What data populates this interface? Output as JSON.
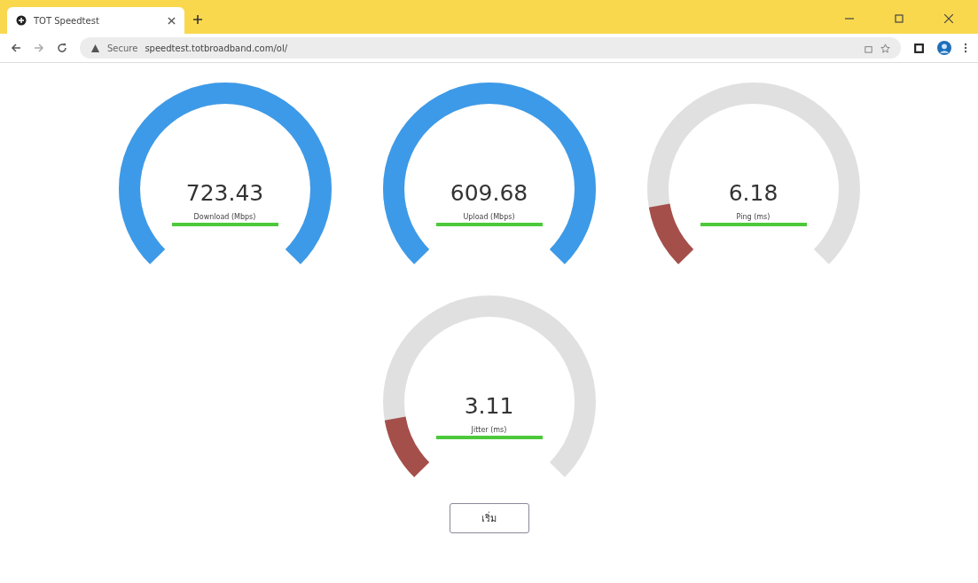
{
  "browser": {
    "tab_title": "TOT Speedtest",
    "security": "Secure",
    "url": "speedtest.totbroadband.com/ol/"
  },
  "gauges": [
    {
      "value": "723.43",
      "label": "Download (Mbps)",
      "kind": "full",
      "color": "#3d9ae8"
    },
    {
      "value": "609.68",
      "label": "Upload (Mbps)",
      "kind": "full",
      "color": "#3d9ae8"
    },
    {
      "value": "6.18",
      "label": "Ping (ms)",
      "kind": "low",
      "color": "#a54f4a"
    },
    {
      "value": "3.11",
      "label": "Jitter (ms)",
      "kind": "low",
      "color": "#a54f4a"
    }
  ],
  "button": "เริ่ม"
}
